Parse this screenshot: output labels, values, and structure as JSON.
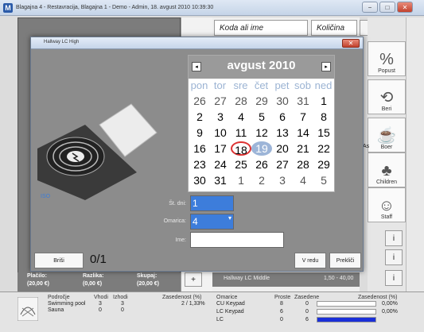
{
  "window": {
    "title": "Blagajna 4 - Restavracija, Blagajna 1 - Demo - Admin, 18. avgust 2010 10:39:30",
    "btn_min": "−",
    "btn_max": "□",
    "btn_close": "✕"
  },
  "search": {
    "code_placeholder": "Koda ali ime",
    "qty_placeholder": "Količina",
    "plus": "+",
    "more": "..."
  },
  "side_buttons": [
    {
      "label": "Popust",
      "icon": "%"
    },
    {
      "label": "Beri",
      "icon": "⟲"
    },
    {
      "label": "Boer",
      "icon": "☕"
    },
    {
      "label": "Children",
      "icon": "♣"
    },
    {
      "label": "Staff",
      "icon": "☺"
    }
  ],
  "info_buttons": [
    "i",
    "i",
    "i"
  ],
  "right_side_label": "As",
  "totals": {
    "placilo_label": "Plačilo:",
    "placilo_value": "(20,00 €)",
    "razlika_label": "Razlika:",
    "razlika_value": "(0,00 €)",
    "skupaj_label": "Skupaj:",
    "skupaj_value": "(20,00 €)"
  },
  "order_row": {
    "add": "+",
    "name": "Hallway LC Middle",
    "value": "1,50 - 40,00"
  },
  "dialog": {
    "title": "Hallway LC High",
    "close": "✕",
    "logo_text": "ISO",
    "calendar": {
      "month": "avgust 2010",
      "prev": "◂",
      "next": "▸",
      "weekdays": [
        "pon",
        "tor",
        "sre",
        "čet",
        "pet",
        "sob",
        "ned"
      ],
      "weeks": [
        [
          "26",
          "27",
          "28",
          "29",
          "30",
          "31",
          "1"
        ],
        [
          "2",
          "3",
          "4",
          "5",
          "6",
          "7",
          "8"
        ],
        [
          "9",
          "10",
          "11",
          "12",
          "13",
          "14",
          "15"
        ],
        [
          "16",
          "17",
          "18",
          "19",
          "20",
          "21",
          "22"
        ],
        [
          "23",
          "24",
          "25",
          "26",
          "27",
          "28",
          "29"
        ],
        [
          "30",
          "31",
          "1",
          "2",
          "3",
          "4",
          "5"
        ]
      ],
      "today": "18",
      "selected": "19"
    },
    "st_dni_label": "Št. dni:",
    "st_dni_value": "1",
    "omarica_label": "Omarica:",
    "omarica_value": "4",
    "ime_label": "Ime:",
    "ime_value": "",
    "brisi": "Briši",
    "counter": "0/1",
    "ok": "V redu",
    "cancel": "Prekliči"
  },
  "bottom": {
    "headers": [
      "Področje",
      "Vhodi",
      "Izhodi",
      "Zasedenost (%)",
      "Omarice",
      "Proste",
      "Zasedene",
      "Zasedenost (%)"
    ],
    "areas": [
      {
        "name": "Swimming pool",
        "in": "3",
        "out": "3",
        "occ": "2 / 1,33%"
      },
      {
        "name": "Sauna",
        "in": "0",
        "out": "0",
        "occ": ""
      }
    ],
    "lockers": [
      {
        "name": "CU Keypad",
        "free": "8",
        "used": "0",
        "occ": "0,00%",
        "fill": 0
      },
      {
        "name": "LC Keypad",
        "free": "6",
        "used": "0",
        "occ": "0,00%",
        "fill": 0
      },
      {
        "name": "LC",
        "free": "0",
        "used": "6",
        "occ": "",
        "fill": 1
      }
    ]
  },
  "colors": {
    "accent": "#3d7ddb",
    "today_ring": "#dd3333",
    "selected_day": "#9db5d8"
  }
}
